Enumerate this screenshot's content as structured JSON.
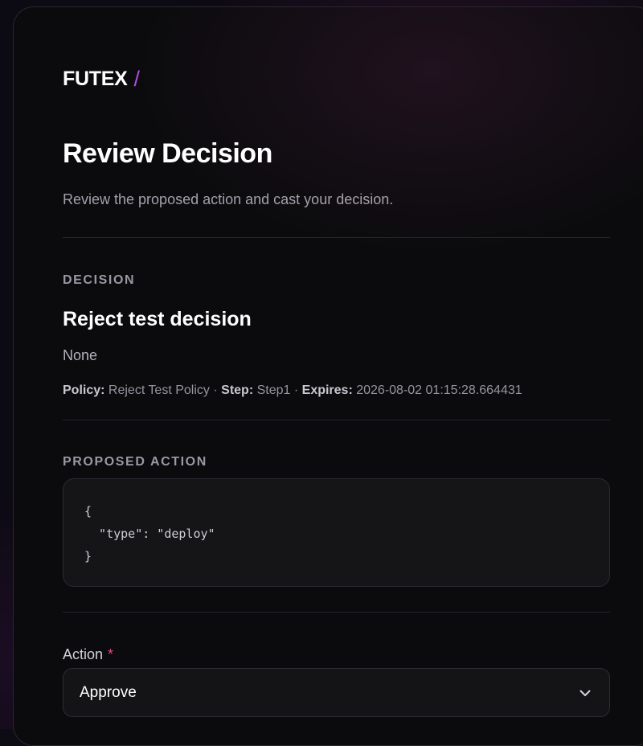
{
  "brand": {
    "name": "FUTEX",
    "separator": "/"
  },
  "header": {
    "title": "Review Decision",
    "subtitle": "Review the proposed action and cast your decision."
  },
  "decision": {
    "section_label": "DECISION",
    "title": "Reject test decision",
    "description": "None",
    "meta": {
      "policy_label": "Policy:",
      "policy_value": "Reject Test Policy",
      "step_label": "Step:",
      "step_value": "Step1",
      "expires_label": "Expires:",
      "expires_value": "2026-08-02 01:15:28.664431",
      "separator": "·"
    }
  },
  "proposed_action": {
    "section_label": "PROPOSED ACTION",
    "code": "{\n  \"type\": \"deploy\"\n}"
  },
  "action_field": {
    "label": "Action",
    "required_marker": "*",
    "selected_value": "Approve",
    "icon": "chevron-down-icon"
  },
  "colors": {
    "accent": "#b04be0",
    "required": "#e0487f",
    "background": "#0b0b0d"
  }
}
